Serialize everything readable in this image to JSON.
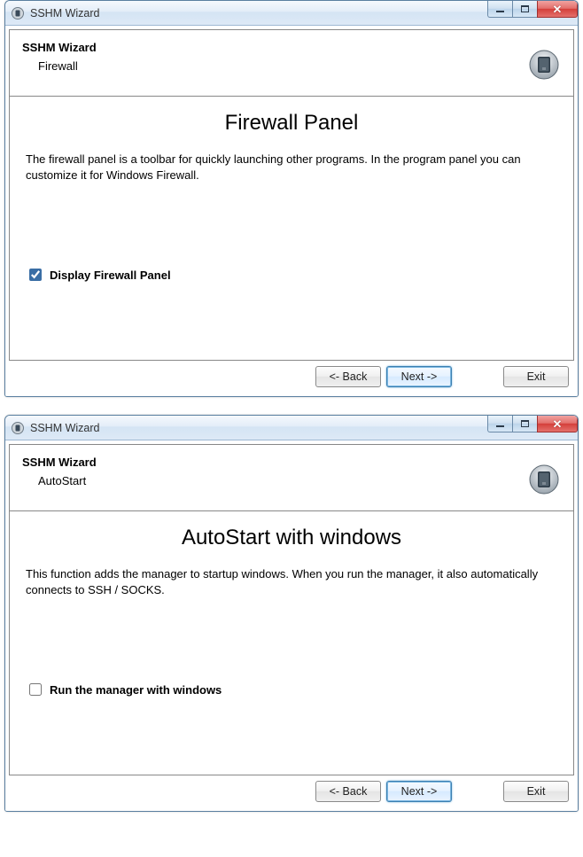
{
  "window1": {
    "title": "SSHM Wizard",
    "header_title": "SSHM Wizard",
    "header_sub": "Firewall",
    "content_title": "Firewall Panel",
    "content_desc": "The firewall panel is a toolbar for quickly launching other programs. In the program panel you can customize it for Windows Firewall.",
    "checkbox_label": "Display Firewall Panel",
    "checkbox_checked": true,
    "buttons": {
      "back": "<- Back",
      "next": "Next ->",
      "exit": "Exit"
    }
  },
  "window2": {
    "title": "SSHM Wizard",
    "header_title": "SSHM Wizard",
    "header_sub": "AutoStart",
    "content_title": "AutoStart with windows",
    "content_desc": "This function adds the manager to startup windows. When you run the manager, it also automatically connects to SSH / SOCKS.",
    "checkbox_label": "Run the manager with windows",
    "checkbox_checked": false,
    "buttons": {
      "back": "<- Back",
      "next": "Next ->",
      "exit": "Exit"
    }
  }
}
